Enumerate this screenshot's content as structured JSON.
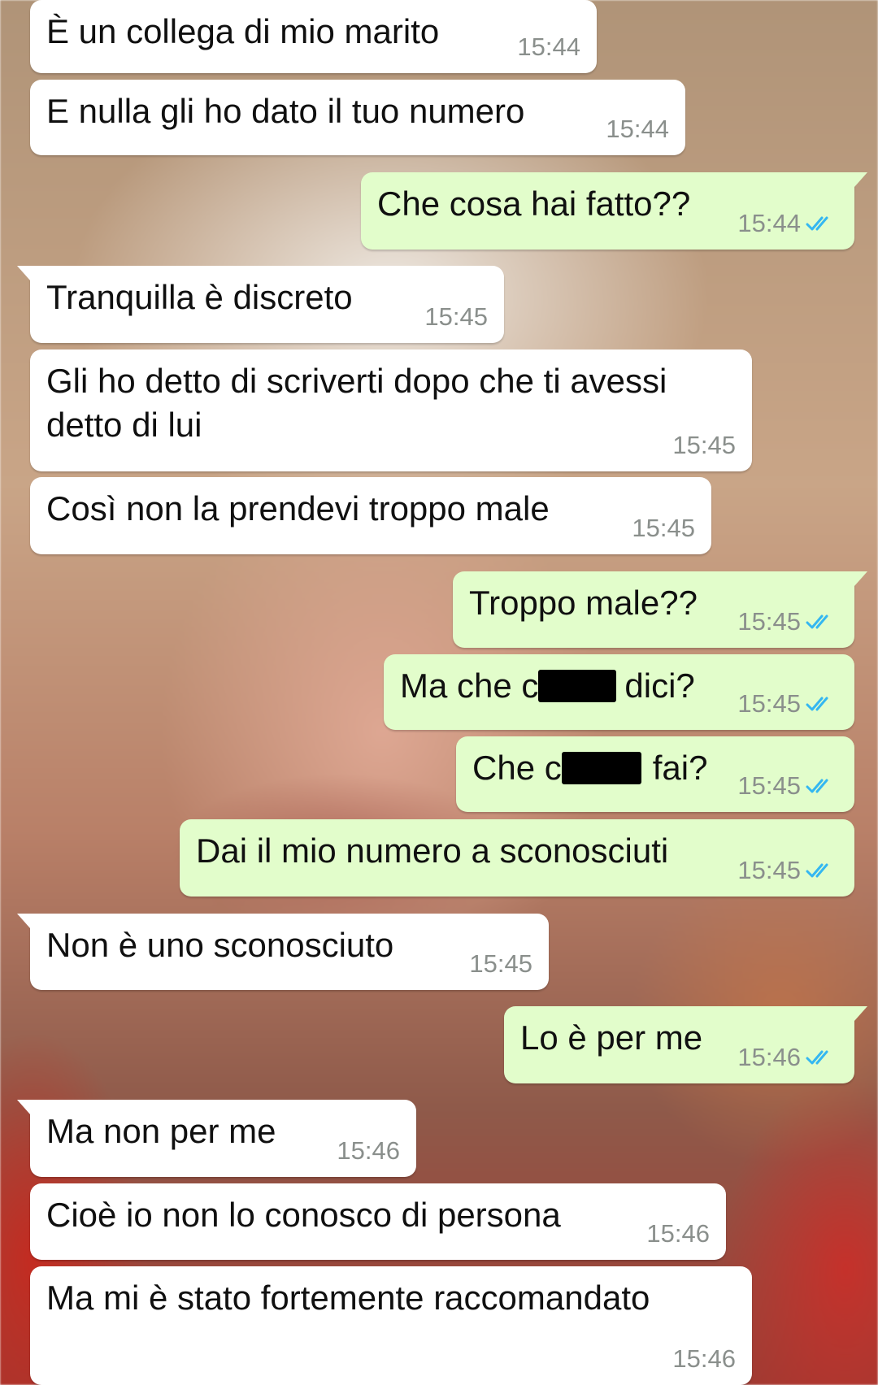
{
  "messages": [
    {
      "text": "È un collega di mio marito",
      "time": "15:44",
      "direction": "incoming"
    },
    {
      "text": "E nulla gli ho dato il tuo numero",
      "time": "15:44",
      "direction": "incoming"
    },
    {
      "text": "Che cosa hai fatto??",
      "time": "15:44",
      "direction": "outgoing",
      "status": "read"
    },
    {
      "text": "Tranquilla è discreto",
      "time": "15:45",
      "direction": "incoming"
    },
    {
      "text_line1": "Gli ho detto di scriverti dopo che ti avessi",
      "text_line2": "detto di lui",
      "time": "15:45",
      "direction": "incoming"
    },
    {
      "text": "Così non la prendevi troppo male",
      "time": "15:45",
      "direction": "incoming"
    },
    {
      "text": "Troppo male??",
      "time": "15:45",
      "direction": "outgoing",
      "status": "read"
    },
    {
      "text_before": "Ma che c",
      "text_after": "dici?",
      "time": "15:45",
      "direction": "outgoing",
      "status": "read",
      "redacted": true
    },
    {
      "text_before": "Che c",
      "text_after": "fai?",
      "time": "15:45",
      "direction": "outgoing",
      "status": "read",
      "redacted": true
    },
    {
      "text": "Dai il mio numero a sconosciuti",
      "time": "15:45",
      "direction": "outgoing",
      "status": "read"
    },
    {
      "text": "Non è uno sconosciuto",
      "time": "15:45",
      "direction": "incoming"
    },
    {
      "text": "Lo è per me",
      "time": "15:46",
      "direction": "outgoing",
      "status": "read"
    },
    {
      "text": "Ma non per me",
      "time": "15:46",
      "direction": "incoming"
    },
    {
      "text": "Cioè io non lo conosco di persona",
      "time": "15:46",
      "direction": "incoming"
    },
    {
      "text": "Ma mi è stato fortemente raccomandato",
      "time": "15:46",
      "direction": "incoming"
    }
  ],
  "colors": {
    "incoming_bubble": "#ffffff",
    "outgoing_bubble": "#e2fdcb",
    "read_ticks": "#34b7f1",
    "timestamp": "#8a8f8c"
  },
  "icons": {
    "read_receipt": "double-check-icon"
  }
}
